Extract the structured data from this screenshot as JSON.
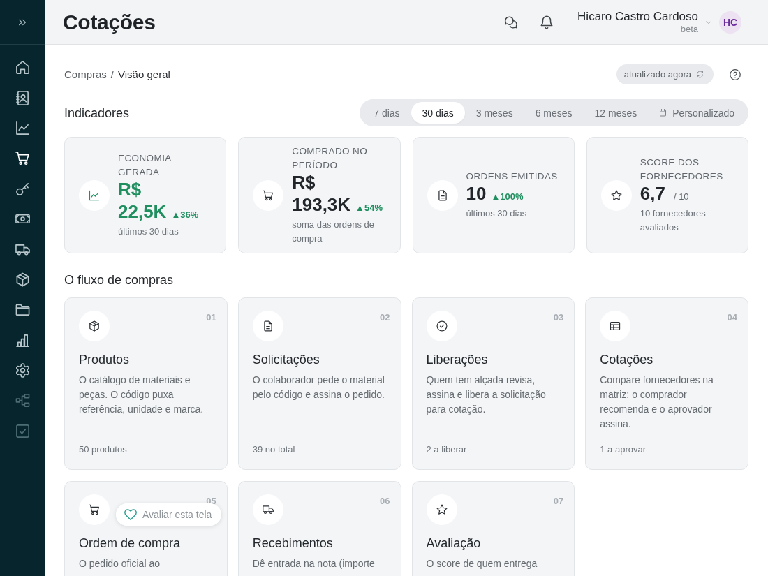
{
  "sidebar": {
    "items": [
      {
        "kind": "home",
        "selected": false,
        "disabled": false
      },
      {
        "kind": "contacts",
        "selected": false,
        "disabled": false
      },
      {
        "kind": "chart",
        "selected": false,
        "disabled": false
      },
      {
        "kind": "cart",
        "selected": true,
        "disabled": false
      },
      {
        "kind": "key",
        "selected": false,
        "disabled": false
      },
      {
        "kind": "cash",
        "selected": false,
        "disabled": false
      },
      {
        "kind": "truck",
        "selected": false,
        "disabled": false
      },
      {
        "kind": "package",
        "selected": false,
        "disabled": false
      },
      {
        "kind": "folder",
        "selected": false,
        "disabled": false
      },
      {
        "kind": "bars",
        "selected": false,
        "disabled": false
      },
      {
        "kind": "settings",
        "selected": false,
        "disabled": false
      },
      {
        "kind": "flow",
        "selected": false,
        "disabled": true
      },
      {
        "kind": "check",
        "selected": false,
        "disabled": true
      }
    ]
  },
  "header": {
    "title": "Cotações",
    "user": {
      "name": "Hicaro Castro Cardoso",
      "role": "beta",
      "initials": "HC"
    }
  },
  "breadcrumb": {
    "separator": "/",
    "items": [
      {
        "label": "Compras",
        "current": false
      },
      {
        "label": "Visão geral",
        "current": true
      }
    ]
  },
  "status": {
    "label": "atualizado agora"
  },
  "indicators": {
    "title": "Indicadores",
    "periods": [
      {
        "label": "7 dias",
        "kind": "preset",
        "selected": false
      },
      {
        "label": "30 dias",
        "kind": "preset",
        "selected": true
      },
      {
        "label": "3 meses",
        "kind": "preset",
        "selected": false
      },
      {
        "label": "6 meses",
        "kind": "preset",
        "selected": false
      },
      {
        "label": "12 meses",
        "kind": "preset",
        "selected": false
      },
      {
        "label": "Personalizado",
        "kind": "custom",
        "selected": false
      }
    ],
    "cards": [
      {
        "kind": "chart",
        "label": "ECONOMIA GERADA",
        "value": "R$ 22,5K",
        "accent": true,
        "delta": "▲36%",
        "note": "últimos 30 dias"
      },
      {
        "kind": "cart",
        "label": "COMPRADO NO PERÍODO",
        "value": "R$ 193,3K",
        "accent": false,
        "delta": "▲54%",
        "note": "soma das ordens de compra"
      },
      {
        "kind": "document",
        "label": "ORDENS EMITIDAS",
        "value": "10",
        "accent": false,
        "delta": "▲100%",
        "note": "últimos 30 dias"
      },
      {
        "kind": "star",
        "label": "SCORE DOS FORNECEDORES",
        "value": "6,7",
        "accent": false,
        "suffix": "/ 10",
        "note": "10 fornecedores avaliados"
      }
    ]
  },
  "flow": {
    "title": "O fluxo de compras",
    "steps": [
      {
        "number": "01",
        "kind": "package",
        "title": "Produtos",
        "description": "O catálogo de materiais e peças. O código puxa referência, unidade e marca.",
        "count": "50 produtos"
      },
      {
        "number": "02",
        "kind": "document",
        "title": "Solicitações",
        "description": "O colaborador pede o material pelo código e assina o pedido.",
        "count": "39 no total"
      },
      {
        "number": "03",
        "kind": "check-circle",
        "title": "Liberações",
        "description": "Quem tem alçada revisa, assina e libera a solicitação para cotação.",
        "count": "2 a liberar"
      },
      {
        "number": "04",
        "kind": "table",
        "title": "Cotações",
        "description": "Compare fornecedores na matriz; o comprador recomenda e o aprovador assina.",
        "count": "1 a aprovar"
      },
      {
        "number": "05",
        "kind": "cart",
        "title": "Ordem de compra",
        "description": "O pedido oficial ao"
      },
      {
        "number": "06",
        "kind": "truck",
        "title": "Recebimentos",
        "description": "Dê entrada na nota (importe"
      },
      {
        "number": "07",
        "kind": "star",
        "title": "Avaliação",
        "description": "O score de quem entrega"
      }
    ]
  },
  "feedback": {
    "label": "Avaliar esta tela"
  }
}
